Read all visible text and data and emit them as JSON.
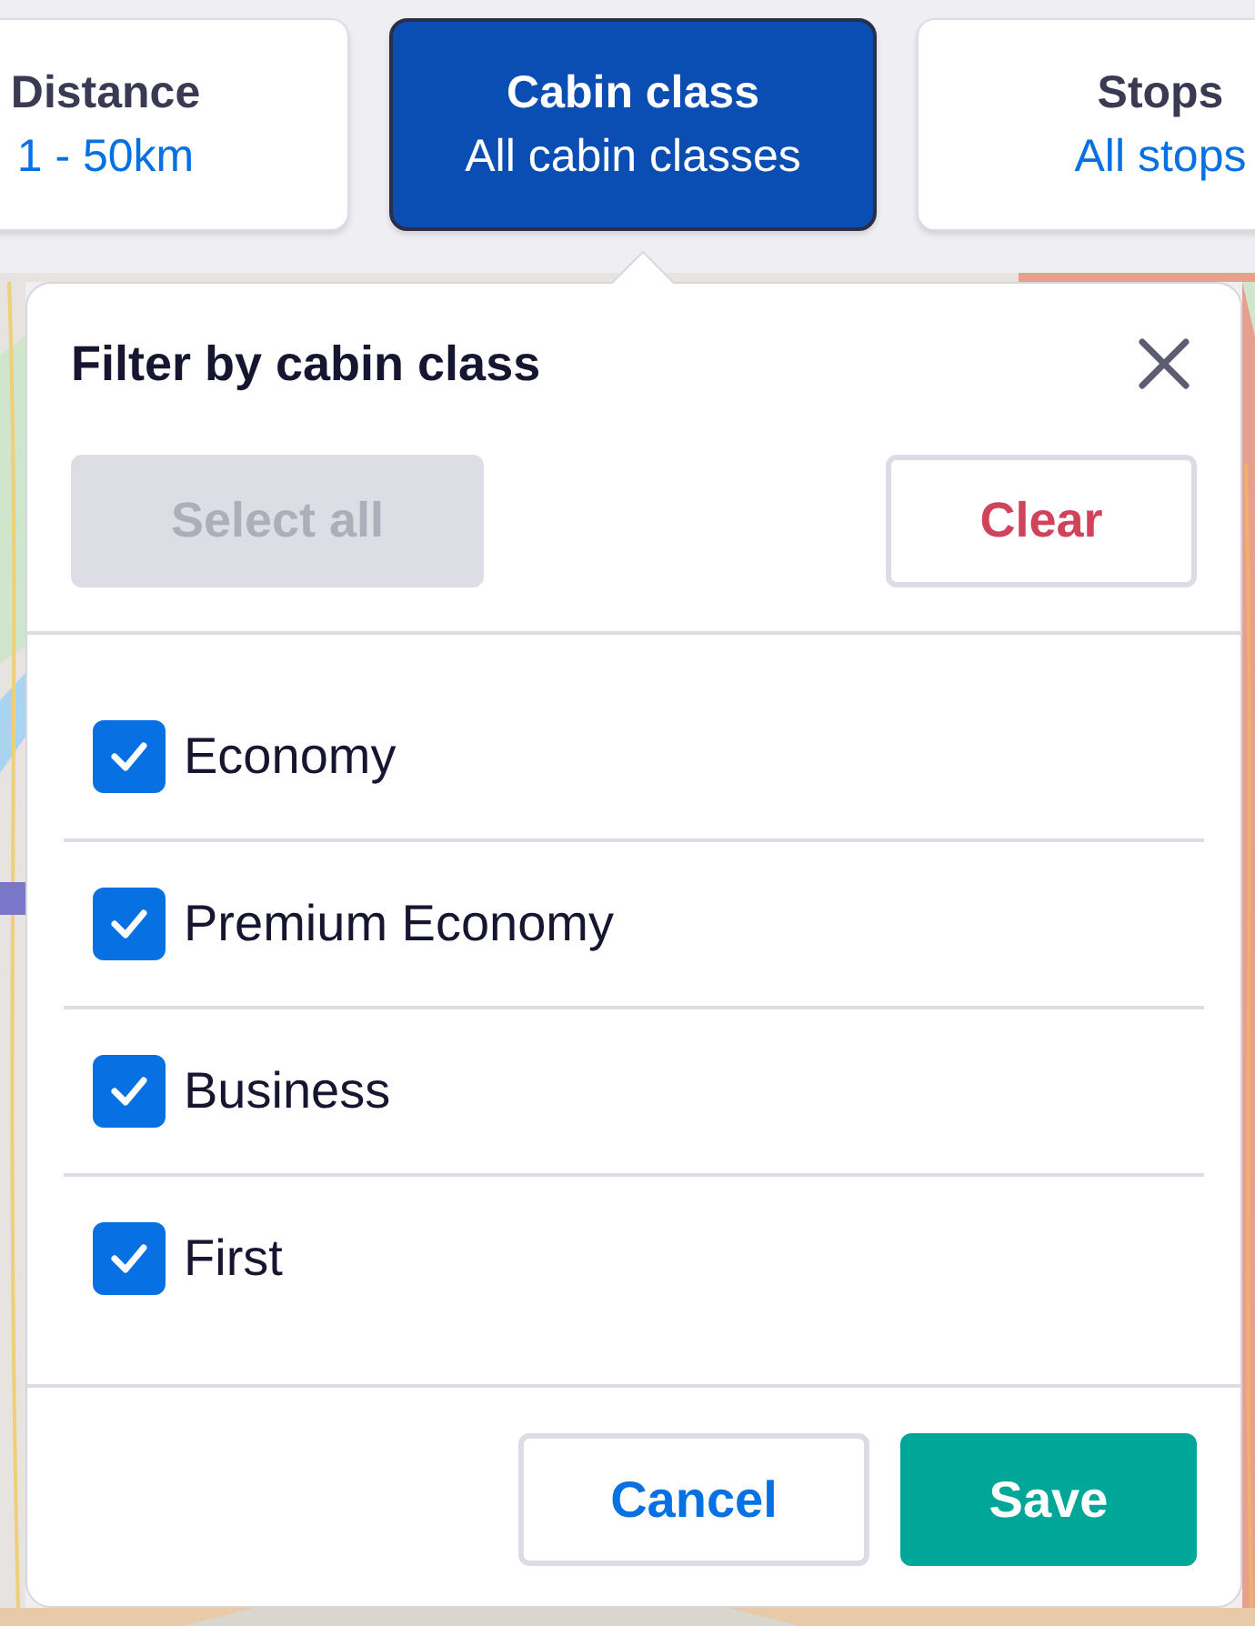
{
  "filters": [
    {
      "label": "Distance",
      "value": "1 - 50km",
      "selected": false
    },
    {
      "label": "Cabin class",
      "value": "All cabin classes",
      "selected": true
    },
    {
      "label": "Stops",
      "value": "All stops",
      "selected": false
    }
  ],
  "popup": {
    "title": "Filter by cabin class",
    "actions": [
      {
        "label": "Select all",
        "kind": "select",
        "disabled": true
      },
      {
        "label": "Clear",
        "kind": "clear",
        "disabled": false
      }
    ],
    "options": [
      {
        "label": "Economy",
        "checked": true
      },
      {
        "label": "Premium Economy",
        "checked": true
      },
      {
        "label": "Business",
        "checked": true
      },
      {
        "label": "First",
        "checked": true
      }
    ],
    "footer": [
      {
        "label": "Cancel",
        "kind": "secondary"
      },
      {
        "label": "Save",
        "kind": "primary"
      }
    ]
  }
}
